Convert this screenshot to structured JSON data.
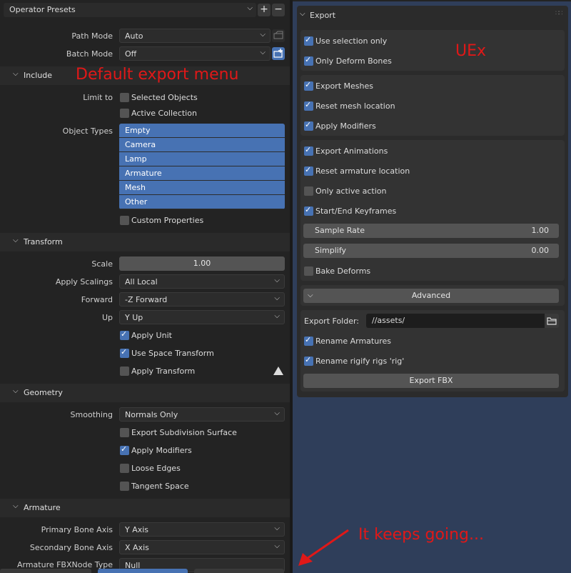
{
  "left": {
    "presets": {
      "label": "Operator Presets",
      "add": "+",
      "remove": "−"
    },
    "path_mode": {
      "label": "Path Mode",
      "value": "Auto"
    },
    "batch_mode": {
      "label": "Batch Mode",
      "value": "Off"
    },
    "annotation": "Default export menu",
    "include": {
      "title": "Include",
      "limit_to": "Limit to",
      "selected_objects": "Selected Objects",
      "active_collection": "Active Collection",
      "object_types_label": "Object Types",
      "object_types": [
        "Empty",
        "Camera",
        "Lamp",
        "Armature",
        "Mesh",
        "Other"
      ],
      "custom_properties": "Custom Properties"
    },
    "transform": {
      "title": "Transform",
      "scale_label": "Scale",
      "scale": "1.00",
      "apply_scalings_label": "Apply Scalings",
      "apply_scalings": "All Local",
      "forward_label": "Forward",
      "forward": "-Z Forward",
      "up_label": "Up",
      "up": "Y Up",
      "apply_unit": "Apply Unit",
      "use_space_transform": "Use Space Transform",
      "apply_transform": "Apply Transform"
    },
    "geometry": {
      "title": "Geometry",
      "smoothing_label": "Smoothing",
      "smoothing": "Normals Only",
      "export_subdivision": "Export Subdivision Surface",
      "apply_modifiers": "Apply Modifiers",
      "loose_edges": "Loose Edges",
      "tangent_space": "Tangent Space"
    },
    "armature": {
      "title": "Armature",
      "primary_label": "Primary Bone Axis",
      "primary": "Y Axis",
      "secondary_label": "Secondary Bone Axis",
      "secondary": "X Axis",
      "node_type_label": "Armature FBXNode Type",
      "node_type": "Null"
    }
  },
  "right": {
    "header": "Export",
    "annotation": "UEx",
    "use_selection_only": "Use selection only",
    "only_deform_bones": "Only Deform Bones",
    "export_meshes": "Export Meshes",
    "reset_mesh_location": "Reset mesh location",
    "apply_modifiers": "Apply Modifiers",
    "export_animations": "Export Animations",
    "reset_armature_location": "Reset armature location",
    "only_active_action": "Only active action",
    "start_end_keyframes": "Start/End Keyframes",
    "sample_rate_label": "Sample Rate",
    "sample_rate": "1.00",
    "simplify_label": "Simplify",
    "simplify": "0.00",
    "bake_deforms": "Bake Deforms",
    "advanced": "Advanced",
    "export_folder_label": "Export Folder:",
    "export_folder": "//assets/",
    "rename_armatures": "Rename Armatures",
    "rename_rigify": "Rename rigify rigs 'rig'",
    "export_fbx": "Export FBX",
    "footer_annotation": "It keeps going..."
  },
  "colors": {
    "accent": "#4772b3",
    "annotation": "#e01818",
    "viewport": "#2f3e5a"
  }
}
